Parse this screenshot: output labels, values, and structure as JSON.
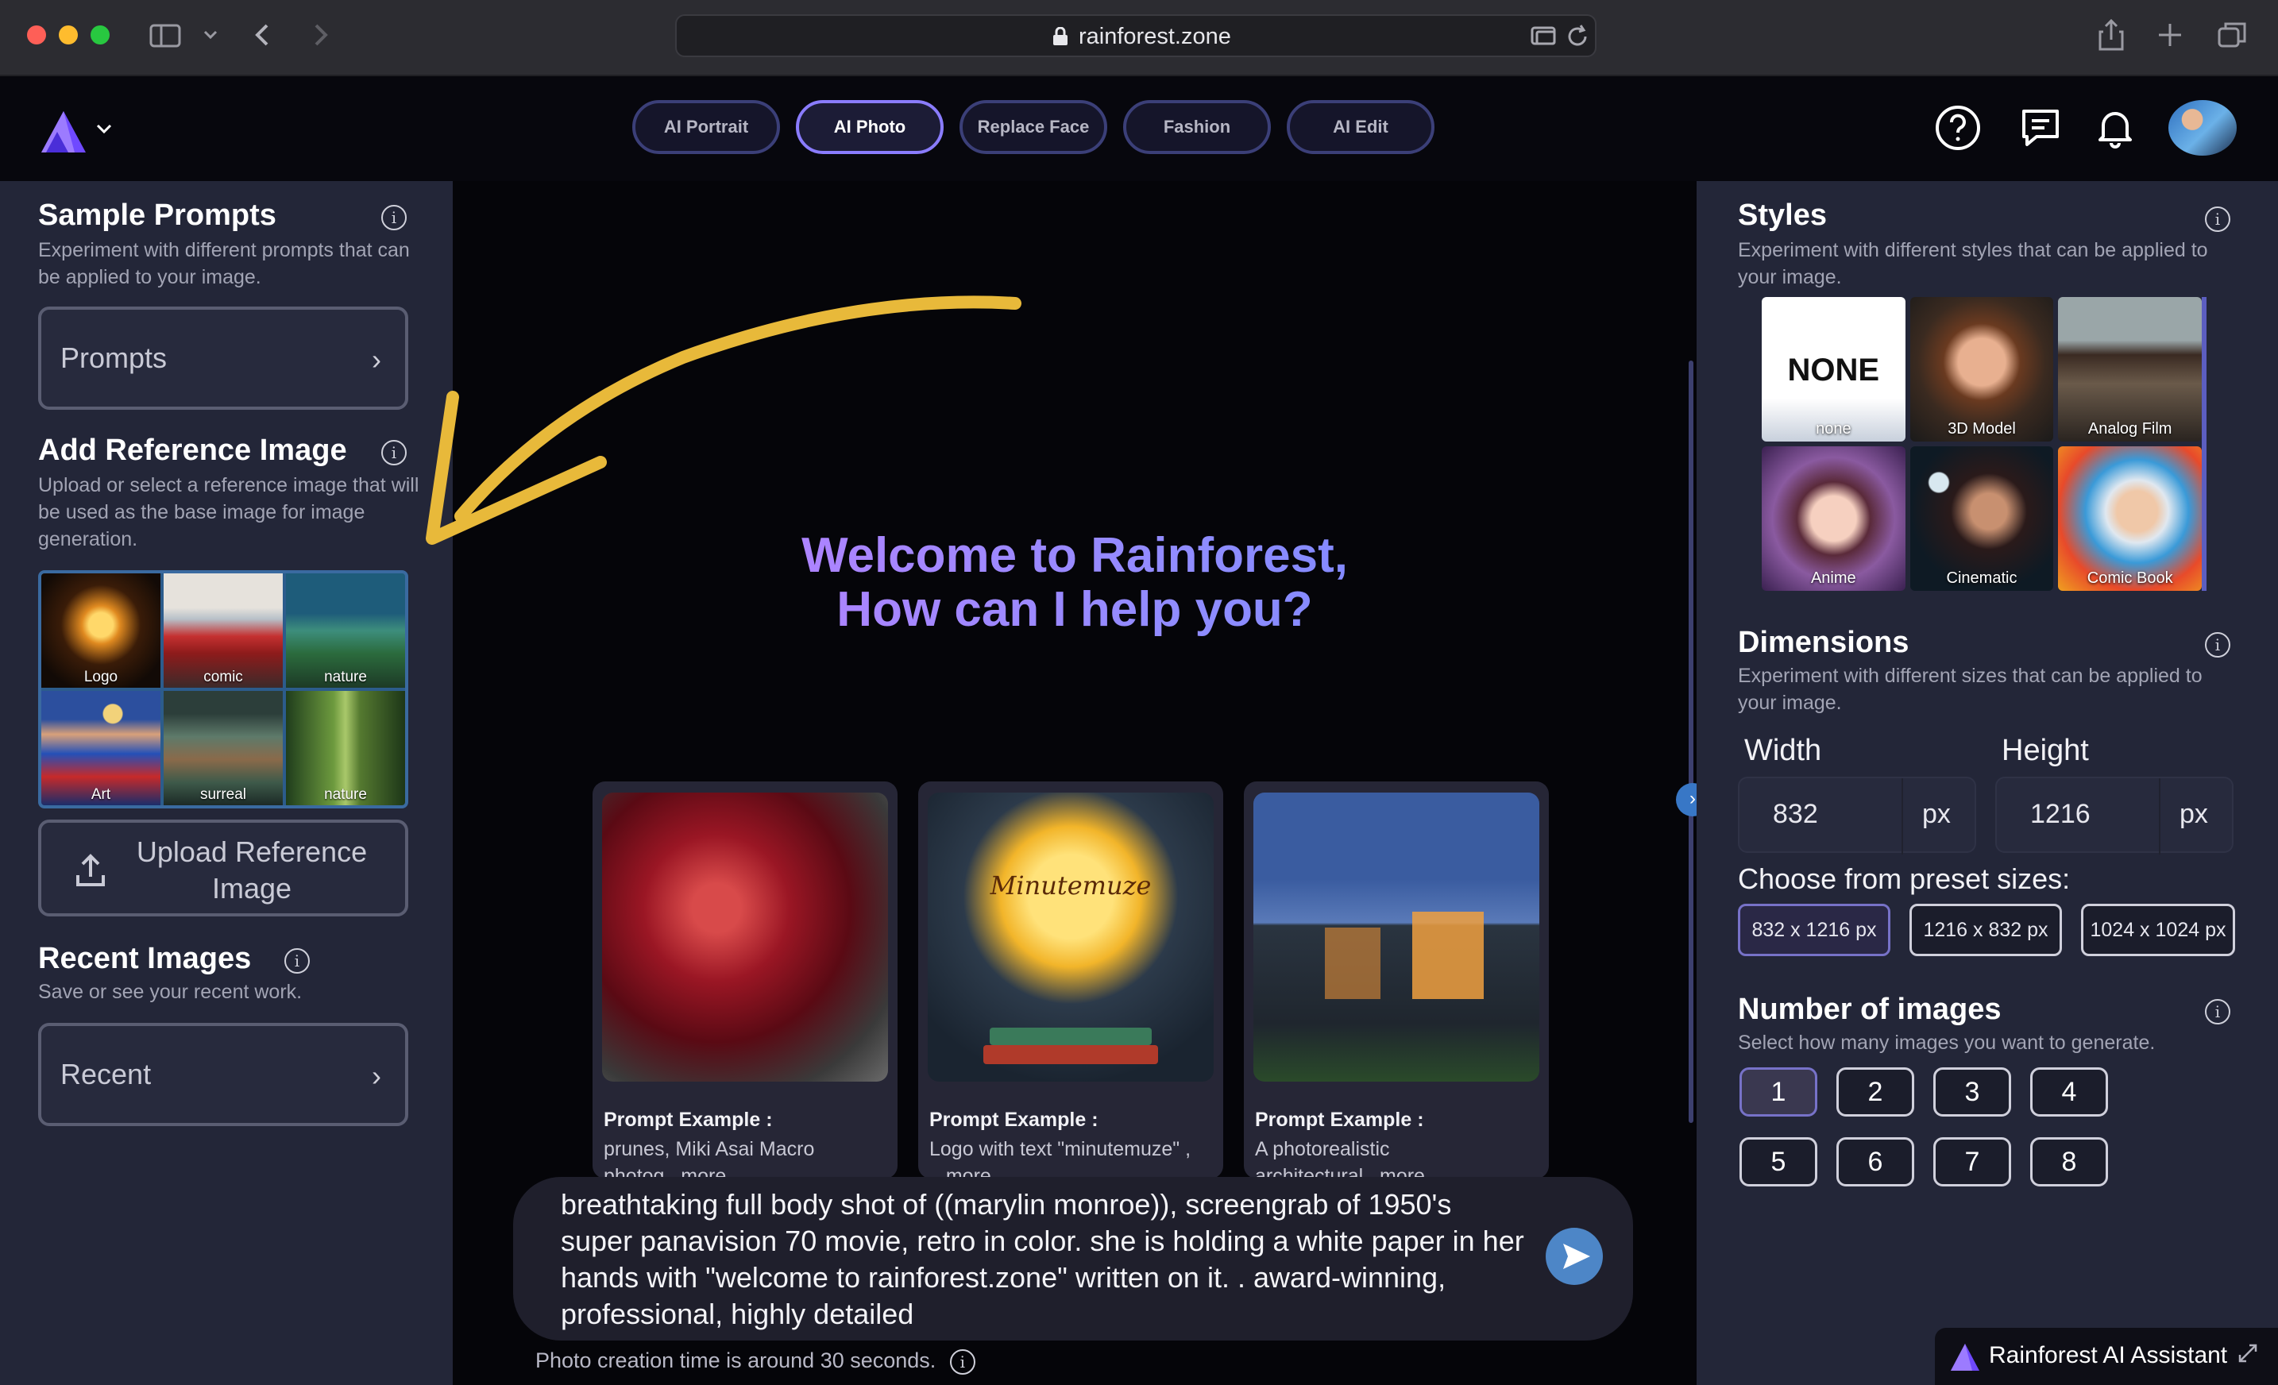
{
  "browser": {
    "url": "rainforest.zone"
  },
  "header": {
    "tabs": [
      {
        "label": "AI Portrait",
        "active": false
      },
      {
        "label": "AI Photo",
        "active": true
      },
      {
        "label": "Replace Face",
        "active": false
      },
      {
        "label": "Fashion",
        "active": false
      },
      {
        "label": "AI Edit",
        "active": false
      }
    ],
    "icons": [
      "question-circle-icon",
      "chat-icon",
      "bell-icon",
      "user-avatar"
    ]
  },
  "left": {
    "sample_prompts": {
      "title": "Sample Prompts",
      "desc": "Experiment with different prompts that can be applied to your image.",
      "button": "Prompts"
    },
    "reference": {
      "title": "Add Reference Image",
      "desc": "Upload or select a reference image that will be used as the base image for image generation.",
      "images": [
        "Logo",
        "comic",
        "nature",
        "Art",
        "surreal",
        "nature"
      ],
      "upload_label": "Upload Reference Image"
    },
    "recent": {
      "title": "Recent Images",
      "desc": "Save or see your recent work.",
      "button": "Recent"
    }
  },
  "center": {
    "welcome_line1": "Welcome to Rainforest,",
    "welcome_line2": "How can I help you?",
    "examples": [
      {
        "title": "Prompt Example :",
        "text": "prunes, Miki Asai Macro photog...more"
      },
      {
        "title": "Prompt Example :",
        "text": "Logo with text \"minutemuze\" , ...more",
        "image_text": "Minutemuze"
      },
      {
        "title": "Prompt Example :",
        "text": "A photorealistic architectural...more"
      }
    ],
    "prompt_text": "breathtaking full body shot of ((marylin monroe)), screengrab of 1950's super panavision 70 movie, retro in color. she is holding a white paper in her hands with \"welcome to rainforest.zone\" written on it. . award-winning, professional, highly detailed",
    "photo_time": "Photo creation time is around 30 seconds."
  },
  "right": {
    "styles": {
      "title": "Styles",
      "desc": "Experiment with different styles that can be applied to your image.",
      "none_text": "NONE",
      "items": [
        "none",
        "3D Model",
        "Analog Film",
        "Anime",
        "Cinematic",
        "Comic Book"
      ]
    },
    "dimensions": {
      "title": "Dimensions",
      "desc": "Experiment with different sizes that can be applied to your image.",
      "width_label": "Width",
      "height_label": "Height",
      "width": "832",
      "height": "1216",
      "unit": "px",
      "preset_label": "Choose from preset sizes:",
      "presets": [
        "832 x 1216 px",
        "1216 x 832 px",
        "1024 x 1024 px"
      ],
      "active_preset": 0
    },
    "num_images": {
      "title": "Number of images",
      "desc": "Select how many images you want to generate.",
      "options": [
        "1",
        "2",
        "3",
        "4",
        "5",
        "6",
        "7",
        "8"
      ],
      "selected": "1"
    },
    "assistant": "Rainforest AI Assistant"
  },
  "colors": {
    "accent": "#8a7cff",
    "welcome_gradient_start": "#c77dff",
    "welcome_gradient_end": "#6a86ff",
    "arrow": "#e8b93a",
    "send": "#4d86c7"
  }
}
